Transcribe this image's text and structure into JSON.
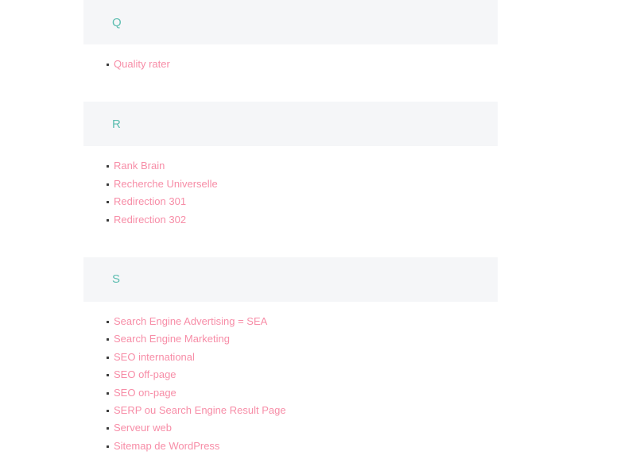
{
  "page": {
    "background_color": "#ffffff",
    "heading_color": "#5cbdb0",
    "link_color": "#f78da7",
    "band_color": "#f5f6f8"
  },
  "sections": [
    {
      "letter": "Q",
      "terms": [
        "Quality rater"
      ]
    },
    {
      "letter": "R",
      "terms": [
        "Rank Brain",
        "Recherche Universelle",
        "Redirection 301",
        "Redirection 302"
      ]
    },
    {
      "letter": "S",
      "terms": [
        "Search Engine Advertising = SEA",
        "Search Engine Marketing",
        "SEO international",
        "SEO off-page",
        "SEO on-page",
        "SERP ou Search Engine Result Page",
        "Serveur web",
        "Sitemap de WordPress"
      ]
    }
  ]
}
